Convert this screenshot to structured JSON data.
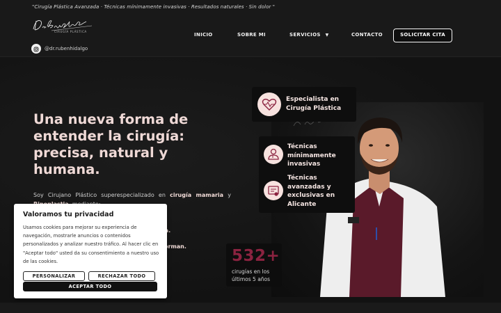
{
  "header": {
    "tagline": "\"Cirugía Plástica Avanzada · Técnicas mínimamente invasivas · Resultados naturales · Sin dolor \"",
    "logo_sub": "CIRUGÍA PLÁSTICA",
    "nav": [
      {
        "label": "INICIO"
      },
      {
        "label": "SOBRE MI"
      },
      {
        "label": "SERVICIOS"
      },
      {
        "label": "CONTACTO"
      }
    ],
    "cta_label": "SOLICITAR CITA",
    "instagram_handle": "@dr.rubenhidalgo"
  },
  "hero": {
    "title": "Una nueva forma de entender la cirugía: precisa, natural y humana.",
    "text_pre": "Soy Cirujano Plástico superespecializado en ",
    "text_bold1": "cirugía mamaria",
    "text_mid": " y ",
    "text_bold2": "Rinoplastia",
    "text_post": ", mediante:",
    "fragment1": "la.",
    "fragment2": "orman."
  },
  "cards": [
    {
      "title": "Especialista en Cirugía Plástica",
      "icon": "heart-pulse-icon"
    },
    {
      "title": "Técnicas mínimamente invasivas",
      "icon": "doctor-icon"
    },
    {
      "title": "Técnicas avanzadas y exclusivas en Alicante",
      "icon": "certificate-icon"
    }
  ],
  "stat": {
    "number": "532+",
    "label": "cirugías en los últimos 5 años"
  },
  "cookie": {
    "title": "Valoramos tu privacidad",
    "body": "Usamos cookies para mejorar su experiencia de navegación, mostrarle anuncios o contenidos personalizados y analizar nuestro tráfico. Al hacer clic en \"Aceptar todo\" usted da su consentimiento a nuestro uso de las cookies.",
    "btn_customize": "PERSONALIZAR",
    "btn_reject": "RECHAZAR TODO",
    "btn_accept": "ACEPTAR TODO"
  },
  "colors": {
    "accent": "#8b2340",
    "background": "#151515",
    "title_tint": "#efd9d6"
  }
}
